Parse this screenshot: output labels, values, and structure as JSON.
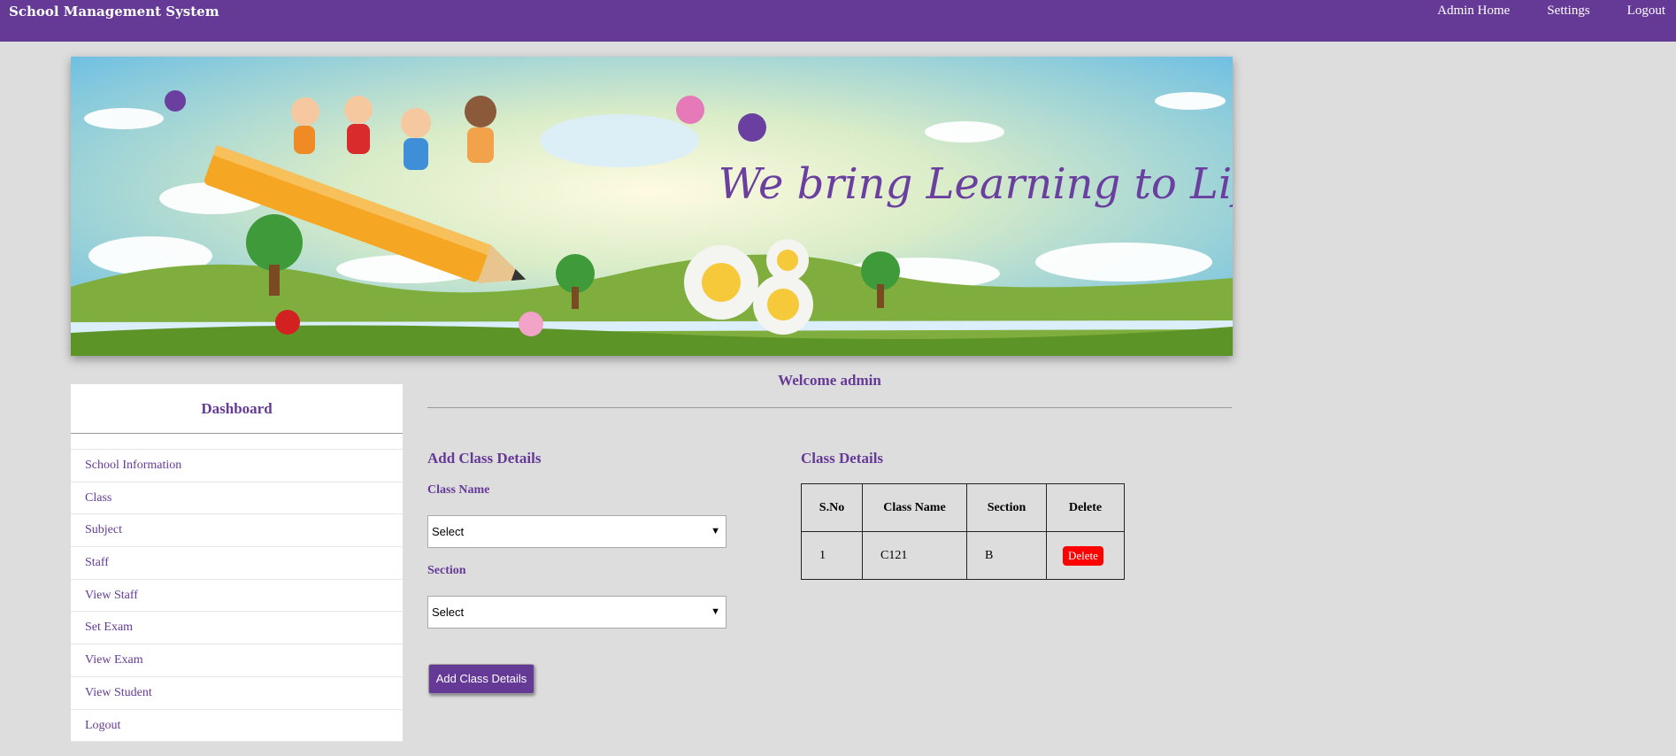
{
  "navbar": {
    "brand": "School Management System",
    "links": [
      "Admin Home",
      "Settings",
      "Logout"
    ]
  },
  "banner": {
    "slogan": "We bring Learning to Life"
  },
  "sidebar": {
    "title": "Dashboard",
    "items": [
      {
        "label": "School Information"
      },
      {
        "label": "Class"
      },
      {
        "label": "Subject"
      },
      {
        "label": "Staff"
      },
      {
        "label": "View Staff"
      },
      {
        "label": "Set Exam"
      },
      {
        "label": "View Exam"
      },
      {
        "label": "View Student"
      },
      {
        "label": "Logout"
      }
    ]
  },
  "main": {
    "welcome": "Welcome admin",
    "form": {
      "title": "Add Class Details",
      "class_name_label": "Class Name",
      "class_name_value": "Select",
      "section_label": "Section",
      "section_value": "Select",
      "submit_label": "Add Class Details"
    },
    "table": {
      "title": "Class Details",
      "headers": [
        "S.No",
        "Class Name",
        "Section",
        "Delete"
      ],
      "rows": [
        {
          "sno": "1",
          "class_name": "C121",
          "section": "B",
          "delete_label": "Delete"
        }
      ]
    }
  },
  "colors": {
    "accent": "#653a96",
    "background": "#dddddd",
    "danger": "#ff0000"
  }
}
